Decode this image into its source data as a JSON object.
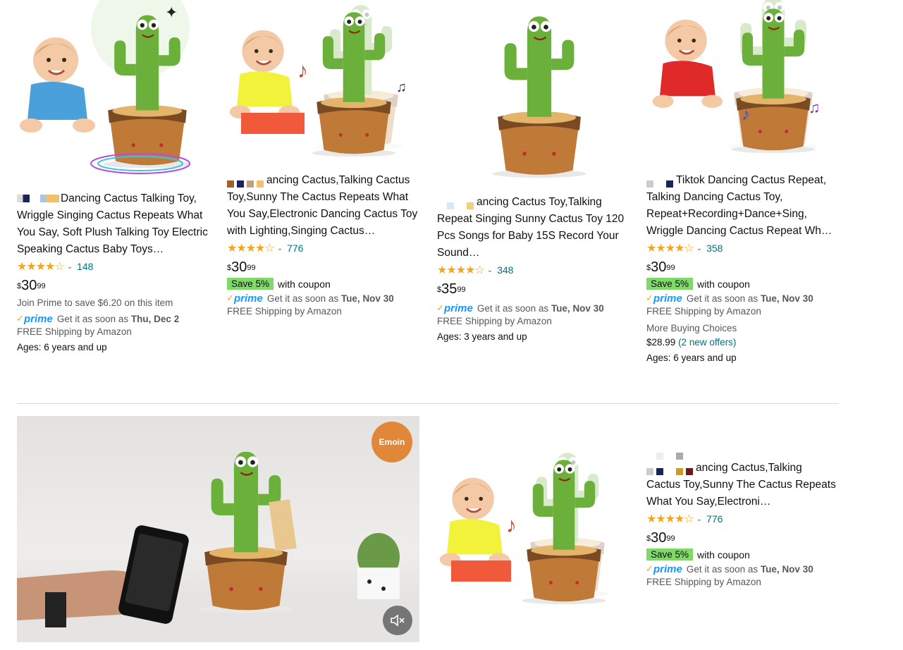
{
  "products": [
    {
      "title": "Dancing Cactus Talking Toy, Wriggle Singing Cactus Repeats What You Say, Soft Plush Talking Toy Electric Speaking Cactus Baby Toys…",
      "rating_count": "148",
      "rating": 4.5,
      "price_whole": "30",
      "price_fraction": "99",
      "currency": "$",
      "prime_save_text": "Join Prime to save $6.20 on this item",
      "delivery_prefix": "Get it as soon as",
      "delivery_date": "Thu, Dec 2",
      "shipping": "FREE Shipping by Amazon",
      "ages": "Ages: 6 years and up"
    },
    {
      "title": "ancing Cactus,Talking Cactus Toy,Sunny The Cactus Repeats What You Say,Electronic Dancing Cactus Toy with Lighting,Singing Cactus…",
      "rating_count": "776",
      "rating": 4.5,
      "price_whole": "30",
      "price_fraction": "99",
      "currency": "$",
      "save_badge": "Save 5%",
      "coupon_text": "with coupon",
      "delivery_prefix": "Get it as soon as",
      "delivery_date": "Tue, Nov 30",
      "shipping": "FREE Shipping by Amazon"
    },
    {
      "title": "ancing Cactus Toy,Talking Repeat Singing Sunny Cactus Toy 120 Pcs Songs for Baby 15S Record Your Sound…",
      "rating_count": "348",
      "rating": 4.5,
      "price_whole": "35",
      "price_fraction": "99",
      "currency": "$",
      "delivery_prefix": "Get it as soon as",
      "delivery_date": "Tue, Nov 30",
      "shipping": "FREE Shipping by Amazon",
      "ages": "Ages: 3 years and up"
    },
    {
      "title": "Tiktok Dancing Cactus Repeat, Talking Dancing Cactus Toy, Repeat+Recording+Dance+Sing, Wriggle Dancing Cactus Repeat Wh…",
      "rating_count": "358",
      "rating": 4.5,
      "price_whole": "30",
      "price_fraction": "99",
      "currency": "$",
      "save_badge": "Save 5%",
      "coupon_text": "with coupon",
      "delivery_prefix": "Get it as soon as",
      "delivery_date": "Tue, Nov 30",
      "shipping": "FREE Shipping by Amazon",
      "more_choices": "More Buying Choices",
      "more_price": "$28.99",
      "more_offers": "(2 new offers)",
      "ages": "Ages: 6 years and up"
    },
    {
      "title": "ancing Cactus,Talking Cactus Toy,Sunny The Cactus Repeats What You Say,Electroni…",
      "rating_count": "776",
      "rating": 4.5,
      "price_whole": "30",
      "price_fraction": "99",
      "currency": "$",
      "save_badge": "Save 5%",
      "coupon_text": "with coupon",
      "delivery_prefix": "Get it as soon as",
      "delivery_date": "Tue, Nov 30",
      "shipping": "FREE Shipping by Amazon"
    }
  ],
  "prime_label": "prime",
  "video": {
    "brand_badge": "Emoin",
    "mute_icon": "mute-icon"
  },
  "colors": {
    "link": "#007185",
    "star": "#f7a41d",
    "save_badge": "#7fda69",
    "prime": "#1399ff"
  }
}
